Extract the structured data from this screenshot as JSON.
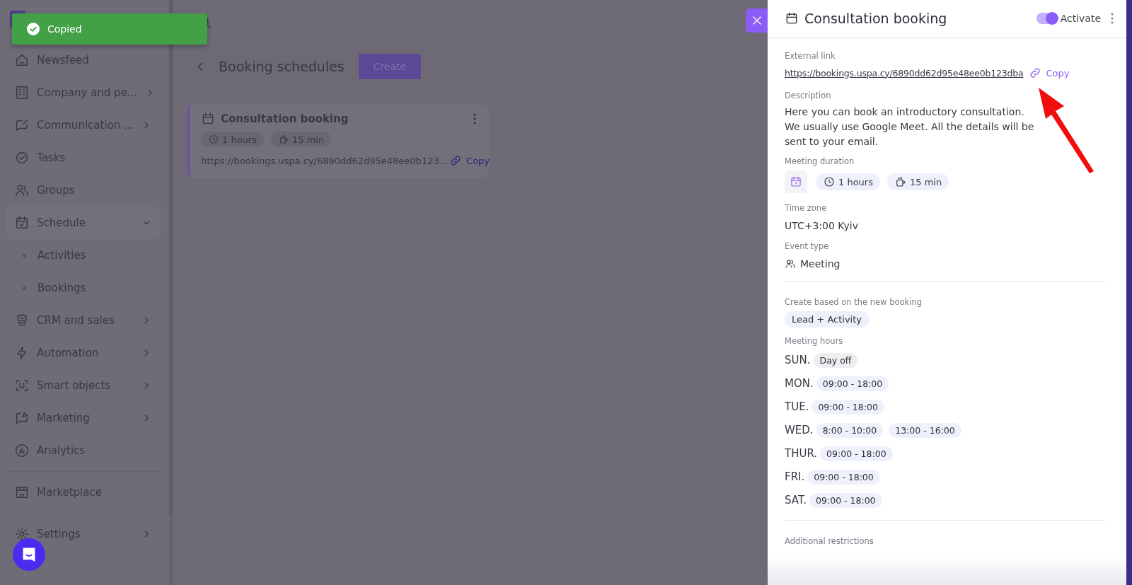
{
  "toast": {
    "text": "Copied"
  },
  "sidebar": {
    "sections": [
      [
        {
          "label": "Newsfeed"
        },
        {
          "label": "Company and pe...",
          "expanded": false
        },
        {
          "label": "Communication ...",
          "expanded": false
        },
        {
          "label": "Tasks"
        },
        {
          "label": "Groups"
        },
        {
          "label": "Schedule",
          "expanded": true,
          "children": [
            {
              "label": "Activities"
            },
            {
              "label": "Bookings"
            }
          ]
        },
        {
          "label": "CRM and sales",
          "expanded": false
        },
        {
          "label": "Automation",
          "expanded": false
        },
        {
          "label": "Smart objects",
          "expanded": false
        },
        {
          "label": "Marketing",
          "expanded": false
        },
        {
          "label": "Analytics"
        }
      ],
      [
        {
          "label": "Marketplace"
        }
      ],
      [
        {
          "label": "Settings",
          "expanded": false
        }
      ]
    ]
  },
  "page": {
    "title": "Booking schedules",
    "create_button": "Create"
  },
  "cards": [
    {
      "title": "Consultation booking",
      "duration": "1 hours",
      "break": "15 min",
      "link": "https://bookings.uspa.cy/6890dd62d95e48ee0b123...",
      "copy": "Copy"
    }
  ],
  "drawer": {
    "title": "Consultation booking",
    "toggle": {
      "label": "Activate",
      "on": true
    },
    "external_link": {
      "label": "External link",
      "url": "https://bookings.uspa.cy/6890dd62d95e48ee0b123dba",
      "copy": "Copy"
    },
    "description": {
      "label": "Description",
      "text": "Here you can book an introductory consultation. We usually use Google Meet. All the details will be sent to your email."
    },
    "meeting_duration": {
      "label": "Meeting duration",
      "duration": "1 hours",
      "break": "15 min"
    },
    "time_zone": {
      "label": "Time zone",
      "value": "UTC+3:00 Kyiv"
    },
    "event_type": {
      "label": "Event type",
      "value": "Meeting"
    },
    "create_based": {
      "label": "Create based on the new booking",
      "value": "Lead + Activity"
    },
    "meeting_hours": {
      "label": "Meeting hours",
      "days": [
        {
          "day": "SUN.",
          "kind": "off",
          "slots": [
            "Day off"
          ]
        },
        {
          "day": "MON.",
          "kind": "open",
          "slots": [
            "09:00 - 18:00"
          ]
        },
        {
          "day": "TUE.",
          "kind": "open",
          "slots": [
            "09:00 - 18:00"
          ]
        },
        {
          "day": "WED.",
          "kind": "open",
          "slots": [
            "8:00 - 10:00",
            "13:00 - 16:00"
          ]
        },
        {
          "day": "THUR.",
          "kind": "open",
          "slots": [
            "09:00 - 18:00"
          ]
        },
        {
          "day": "FRI.",
          "kind": "open",
          "slots": [
            "09:00 - 18:00"
          ]
        },
        {
          "day": "SAT.",
          "kind": "open",
          "slots": [
            "09:00 - 18:00"
          ]
        }
      ]
    },
    "additional": {
      "label": "Additional restrictions"
    }
  }
}
